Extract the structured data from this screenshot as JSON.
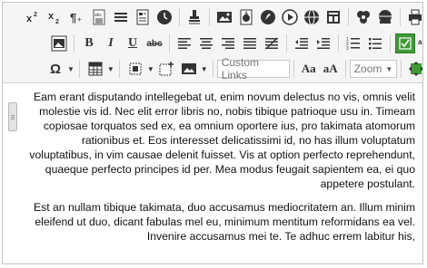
{
  "toolbar": {
    "row1": [
      "superscript-icon",
      "subscript-icon",
      "pilcrow-icon",
      "spellcheck-icon",
      "horizontal-rule-icon",
      "page-break-icon",
      "clock-icon",
      "format-painter-icon",
      "image-icon",
      "flash-icon",
      "media-icon",
      "video-icon",
      "globe-icon",
      "template-icon",
      "shield-icon",
      "print-icon",
      "chevron-right-icon"
    ],
    "row2": [
      "image-frame-icon",
      "bold-icon",
      "italic-icon",
      "underline-icon",
      "strikethrough-icon",
      "align-left-icon",
      "align-center-icon",
      "align-right-icon",
      "align-justify-icon",
      "clear-format-icon",
      "outdent-icon",
      "indent-icon",
      "numbered-list-icon",
      "bulleted-list-icon",
      "track-changes-icon",
      "spellcheck-settings-icon"
    ],
    "bold_label": "B",
    "italic_label": "I",
    "underline_label": "U",
    "strike_label": "abc",
    "omega_label": "Ω",
    "custom_links_label": "Custom Links",
    "zoom_label": "Zoom",
    "font_size_a": "Aa",
    "font_size_b": "aA",
    "spell_label": "abc",
    "accent_color": "#3f9a36"
  },
  "content": {
    "paragraphs": [
      "Eam erant disputando intellegebat ut, enim novum delectus no vis, omnis velit molestie vis id. Nec elit error libris no, nobis tibique patrioque usu in. Timeam copiosae torquatos sed ex, ea omnium oportere ius, pro takimata atomorum rationibus et. Eos interesset delicatissimi id, no has illum voluptatum voluptatibus, in vim causae delenit fuisset. Vis at option perfecto reprehendunt, quaeque perfecto principes id per. Mea modus feugait sapientem ea, ei quo appetere postulant.",
      "Est an nullam tibique takimata, duo accusamus mediocritatem an. Illum minim eleifend ut duo, dicant fabulas mel eu, minimum mentitum reformidans ea vel. Invenire accusamus mei te. Te adhuc errem labitur his,"
    ]
  }
}
